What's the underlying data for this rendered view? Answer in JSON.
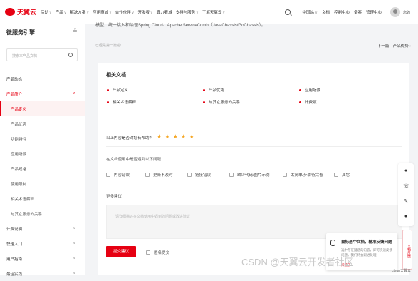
{
  "header": {
    "logo_text": "天翼云",
    "nav": [
      {
        "label": "活动",
        "has_chevron": true
      },
      {
        "label": "产品",
        "has_chevron": true
      },
      {
        "label": "解决方案",
        "has_chevron": true
      },
      {
        "label": "应用商城",
        "has_chevron": true
      },
      {
        "label": "合作伙伴",
        "has_chevron": true
      },
      {
        "label": "开发者",
        "has_chevron": true
      },
      {
        "label": "算力者城",
        "has_chevron": false
      },
      {
        "label": "支持与服务",
        "has_chevron": true
      },
      {
        "label": "了解天翼云",
        "has_chevron": true
      }
    ],
    "right": {
      "region": "中国站",
      "docs": "文档",
      "console": "控制中心",
      "filing": "备案",
      "manage": "管理中心",
      "user": "您的"
    }
  },
  "sidebar": {
    "title": "微服务引擎",
    "search_placeholder": "搜索本产品文档",
    "items": [
      {
        "label": "产品动态",
        "level": 0,
        "chevron": ""
      },
      {
        "label": "产品简介",
        "level": 0,
        "chevron": "up",
        "state": "active-parent"
      },
      {
        "label": "产品定义",
        "level": 1,
        "state": "active"
      },
      {
        "label": "产品优势",
        "level": 1
      },
      {
        "label": "功能特性",
        "level": 1
      },
      {
        "label": "应用场景",
        "level": 1
      },
      {
        "label": "产品规格",
        "level": 1
      },
      {
        "label": "使用限制",
        "level": 1
      },
      {
        "label": "相关术语解释",
        "level": 1
      },
      {
        "label": "与其它服务的关系",
        "level": 1
      },
      {
        "label": "计费说明",
        "level": 0,
        "chevron": "down"
      },
      {
        "label": "快速入门",
        "level": 0,
        "chevron": "down"
      },
      {
        "label": "用户指南",
        "level": 0,
        "chevron": "down"
      },
      {
        "label": "最佳实践",
        "level": 0,
        "chevron": "down"
      }
    ]
  },
  "main": {
    "intro_text": "模型，统一接入和治理Spring Cloud、Apache ServiceComb（JavaChassis/GoChassis）。",
    "prev_label": "已经是第一篇啦!",
    "next_prefix": "下一篇",
    "next_title": "产品优势",
    "related": {
      "title": "相关文档",
      "items": [
        "产品定义",
        "产品优势",
        "应用场景",
        "相关术语解释",
        "与其它服务的关系",
        "计费项"
      ]
    },
    "feedback": {
      "question": "以上内容是否对您有帮助?",
      "stars": "★ ★ ★ ★ ★",
      "problem_prompt": "在文档使用中是否遇到以下问题",
      "options": [
        "内容错误",
        "更新不及时",
        "链接错误",
        "缺少代码/图片示例",
        "太简单/步骤待完善",
        "其它"
      ],
      "more_label": "更多建议",
      "textarea_placeholder": "请详细描述在文档使用中遇到的问题或改进建议",
      "submit_label": "提交建议",
      "anonymous_label": "匿名提交"
    }
  },
  "floating": {
    "popup_title": "鼠标选中文档，精准反馈问题",
    "popup_body": "选中存在疑惑的内容，即可快速反馈问题，我们将会跟进处理",
    "popup_link": "知道了",
    "side_tab": "文档反馈"
  },
  "watermark": {
    "text": "CSDN @天翼云开发者社区",
    "corner": "ctyun天翼云"
  },
  "colors": {
    "brand": "#e60012",
    "star": "#f5a623"
  }
}
